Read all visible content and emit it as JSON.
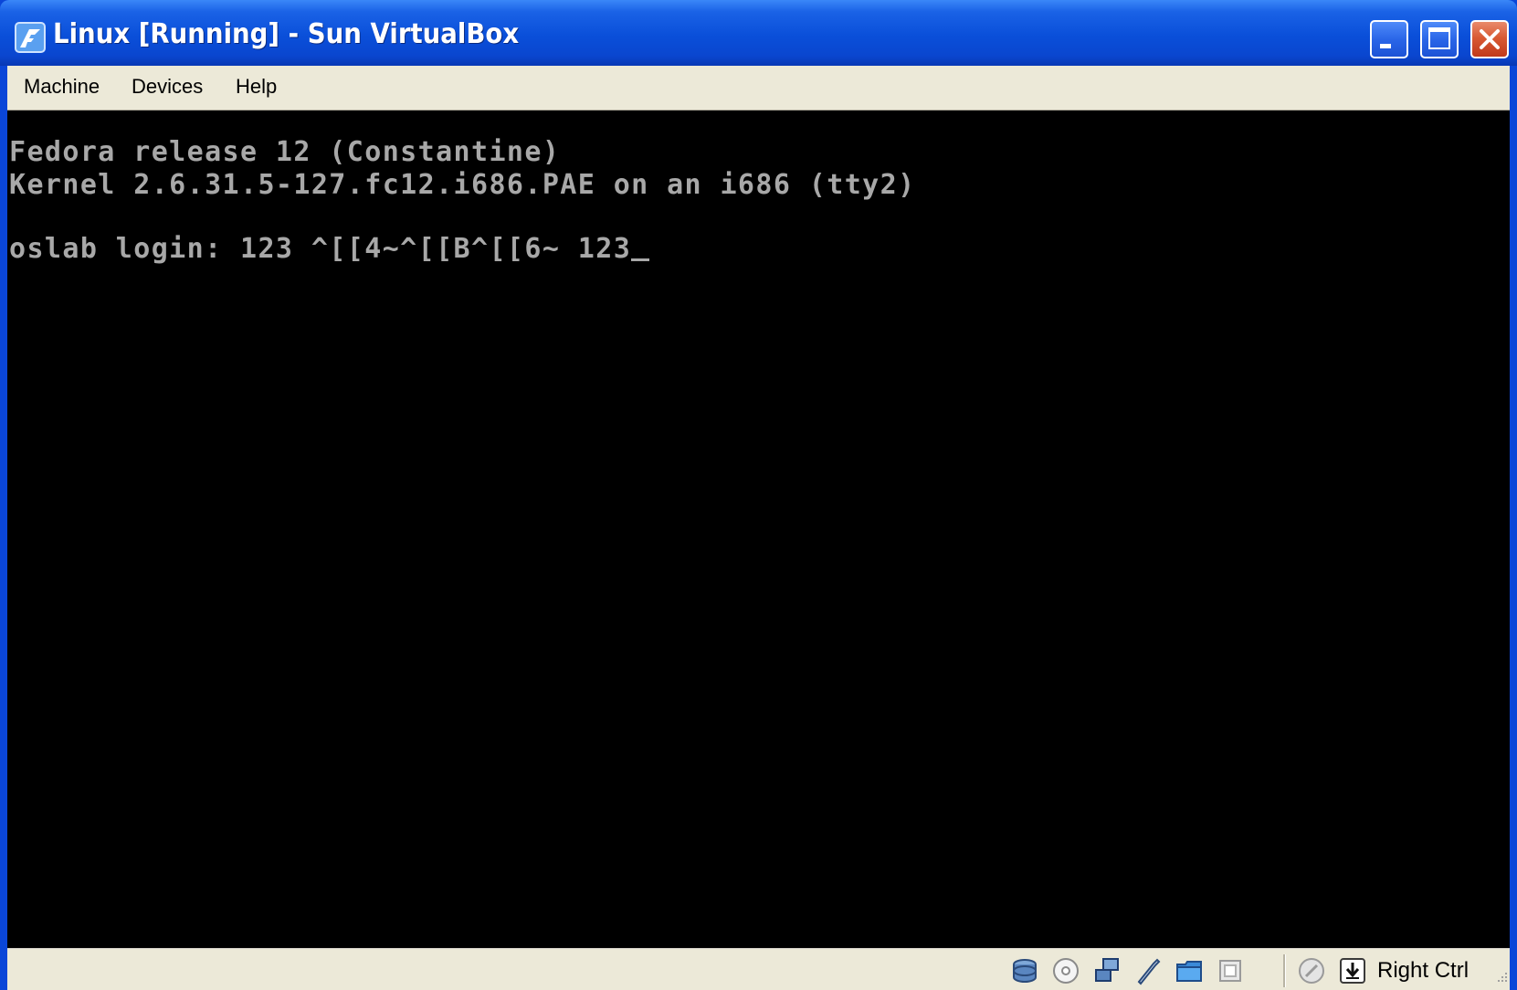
{
  "window": {
    "title": "Linux [Running] - Sun VirtualBox"
  },
  "menu": {
    "items": [
      "Machine",
      "Devices",
      "Help"
    ]
  },
  "console": {
    "lines": [
      "Fedora release 12 (Constantine)",
      "Kernel 2.6.31.5-127.fc12.i686.PAE on an i686 (tty2)",
      "",
      "oslab login: 123 ^[[4~^[[B^[[6~ 123"
    ]
  },
  "statusbar": {
    "icons": [
      "hard-disk-icon",
      "cd-dvd-icon",
      "network-icon",
      "usb-icon",
      "shared-folders-icon",
      "virtualization-icon",
      "mouse-integration-icon",
      "host-key-icon"
    ],
    "host_key_label": "Right Ctrl"
  },
  "colors": {
    "titlebar": "#0a4fd9",
    "menubar": "#ece9d8",
    "console_bg": "#000000",
    "console_text": "#a8a8a8",
    "close_button": "#d95a33"
  }
}
